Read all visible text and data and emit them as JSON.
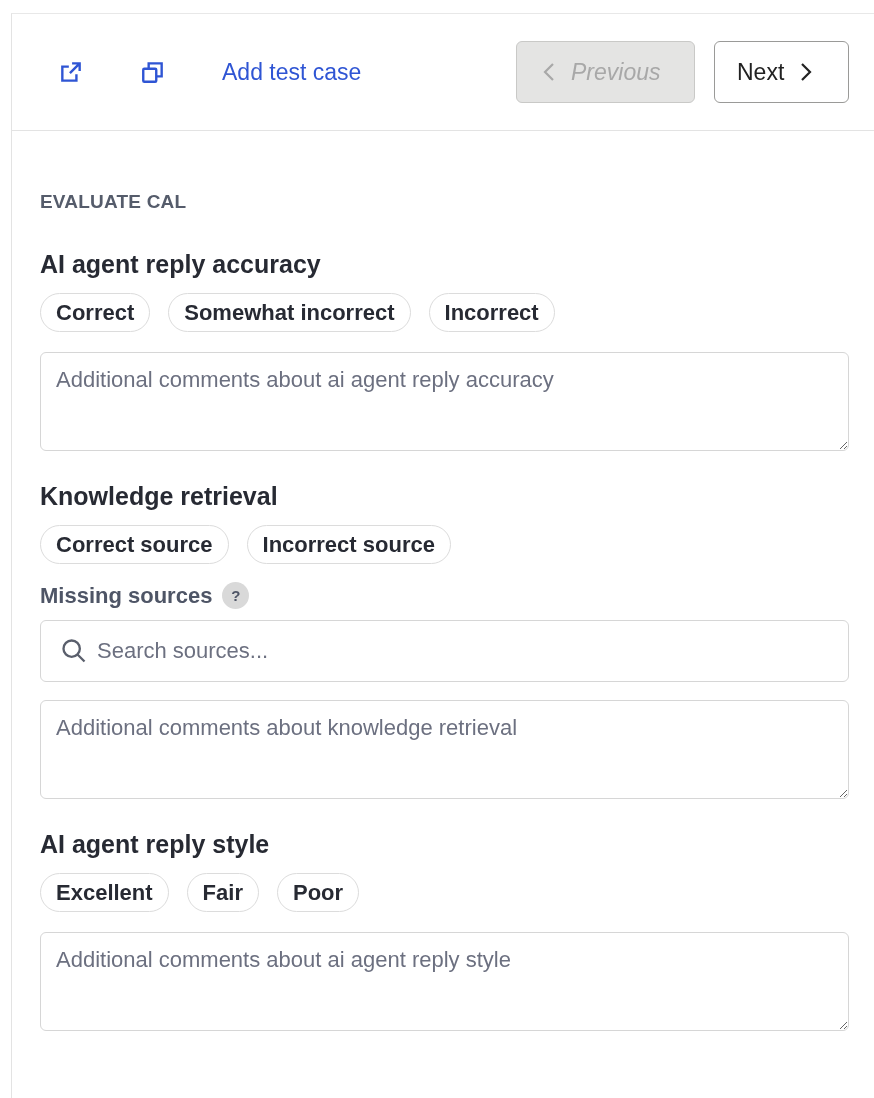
{
  "toolbar": {
    "link": "Add test case",
    "previous": {
      "label": "Previous",
      "disabled": true
    },
    "next": {
      "label": "Next",
      "disabled": false
    }
  },
  "section_label": "EVALUATE CAL",
  "criteria": [
    {
      "title": "AI agent reply accuracy",
      "options": [
        {
          "label": "Correct",
          "selected": false
        },
        {
          "label": "Somewhat incorrect",
          "selected": false
        },
        {
          "label": "Incorrect",
          "selected": false
        }
      ],
      "comment_placeholder": "Additional comments about ai agent reply accuracy"
    },
    {
      "title": "Knowledge retrieval",
      "options": [
        {
          "label": "Correct source",
          "selected": false
        },
        {
          "label": "Incorrect source",
          "selected": false
        }
      ],
      "missing_sources": {
        "label": "Missing sources",
        "help": "?",
        "placeholder": "Search sources..."
      },
      "comment_placeholder": "Additional comments about knowledge retrieval"
    },
    {
      "title": "AI agent reply style",
      "options": [
        {
          "label": "Excellent",
          "selected": false
        },
        {
          "label": "Fair",
          "selected": false
        },
        {
          "label": "Poor",
          "selected": false
        }
      ],
      "comment_placeholder": "Additional comments about ai agent reply style"
    }
  ]
}
